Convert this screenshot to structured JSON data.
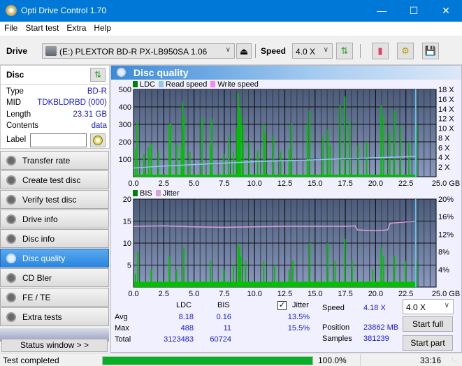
{
  "window": {
    "title": "Opti Drive Control 1.70",
    "minimize_icon": "minimize-icon",
    "maximize_icon": "maximize-icon",
    "close_icon": "close-icon"
  },
  "menu": [
    "File",
    "Start test",
    "Extra",
    "Help"
  ],
  "toolbar": {
    "drive_label": "Drive",
    "drive_value": "(E:)  PLEXTOR BD-R  PX-LB950SA 1.06",
    "speed_label": "Speed",
    "speed_value": "4.0 X",
    "icons": [
      "eject-icon",
      "refresh-swap-icon",
      "eraser-icon",
      "settings-gears-icon",
      "save-icon"
    ]
  },
  "disc": {
    "header": "Disc",
    "fields": [
      {
        "key": "Type",
        "value": "BD-R"
      },
      {
        "key": "MID",
        "value": "TDKBLDRBD (000)"
      },
      {
        "key": "Length",
        "value": "23.31 GB"
      },
      {
        "key": "Contents",
        "value": "data"
      }
    ],
    "label_key": "Label",
    "label_value": ""
  },
  "nav": [
    {
      "label": "Transfer rate",
      "active": false
    },
    {
      "label": "Create test disc",
      "active": false
    },
    {
      "label": "Verify test disc",
      "active": false
    },
    {
      "label": "Drive info",
      "active": false
    },
    {
      "label": "Disc info",
      "active": false
    },
    {
      "label": "Disc quality",
      "active": true
    },
    {
      "label": "CD Bler",
      "active": false
    },
    {
      "label": "FE / TE",
      "active": false
    },
    {
      "label": "Extra tests",
      "active": false
    }
  ],
  "status_window_button": "Status window > >",
  "panel": {
    "title": "Disc quality"
  },
  "colors": {
    "ldc": "#00c000",
    "read_speed": "#8cc8f0",
    "write_speed": "#ff80ff",
    "bis": "#00c000",
    "jitter": "#d8a0d8",
    "plot_bg_top": "#4a5a7a",
    "plot_bg_bottom": "#8a9ac0",
    "accent": "#0078d7",
    "value_text": "#1a1acd",
    "progress": "#06b025"
  },
  "chart_data": [
    {
      "type": "bar",
      "title": "LDC / Read speed",
      "legend": [
        "LDC",
        "Read speed",
        "Write speed"
      ],
      "xlabel": "GB",
      "x_ticks": [
        "0.0",
        "2.5",
        "5.0",
        "7.5",
        "10.0",
        "12.5",
        "15.0",
        "17.5",
        "20.0",
        "22.5",
        "25.0 GB"
      ],
      "xlim": [
        0,
        25
      ],
      "y_ticks_left": [
        "100",
        "200",
        "300",
        "400",
        "500"
      ],
      "ylim_left": [
        0,
        500
      ],
      "y_ticks_right": [
        "2 X",
        "4 X",
        "6 X",
        "8 X",
        "10 X",
        "12 X",
        "14 X",
        "16 X",
        "18 X"
      ],
      "ylim_right": [
        0,
        18
      ],
      "grid": true,
      "legend_position": "top-left",
      "series": [
        {
          "name": "LDC",
          "x": [
            0.1,
            0.25,
            0.8,
            1.2,
            1.4,
            2.0,
            2.9,
            3.0,
            3.5,
            3.9,
            4.0,
            4.1,
            4.6,
            5.6,
            6.3,
            6.4,
            7.4,
            7.8,
            8.2,
            8.5,
            8.6,
            8.7,
            8.8,
            9.0,
            9.5,
            10.2,
            10.7,
            10.8,
            11.5,
            12.1,
            12.8,
            13.0,
            14.3,
            14.5,
            15.6,
            16.0,
            16.2,
            17.0,
            17.4,
            17.8,
            18.5,
            19.2,
            20.4,
            20.6,
            21.1,
            21.5,
            22.0,
            22.7,
            23.3
          ],
          "values": [
            160,
            310,
            130,
            170,
            190,
            150,
            300,
            305,
            190,
            170,
            430,
            340,
            145,
            340,
            180,
            330,
            130,
            240,
            140,
            280,
            475,
            400,
            350,
            300,
            200,
            150,
            300,
            250,
            230,
            145,
            160,
            305,
            300,
            380,
            230,
            270,
            180,
            410,
            460,
            320,
            180,
            200,
            410,
            350,
            260,
            380,
            290,
            200,
            300
          ]
        },
        {
          "name": "Read speed",
          "x": [
            0,
            2.5,
            5,
            7.5,
            10,
            12.5,
            15,
            17.5,
            20,
            22.5,
            23.3
          ],
          "values": [
            1.8,
            2.2,
            2.5,
            2.8,
            3.1,
            3.3,
            3.5,
            3.7,
            3.9,
            4.1,
            4.2
          ],
          "axis": "right"
        },
        {
          "name": "Write speed",
          "x": [],
          "values": []
        }
      ],
      "end_marker_x": 23.31
    },
    {
      "type": "bar",
      "title": "BIS / Jitter",
      "legend": [
        "BIS",
        "Jitter"
      ],
      "xlabel": "GB",
      "x_ticks": [
        "0.0",
        "2.5",
        "5.0",
        "7.5",
        "10.0",
        "12.5",
        "15.0",
        "17.5",
        "20.0",
        "22.5",
        "25.0 GB"
      ],
      "xlim": [
        0,
        25
      ],
      "y_ticks_left": [
        "5",
        "10",
        "15",
        "20"
      ],
      "ylim_left": [
        0,
        20
      ],
      "y_ticks_right": [
        "4%",
        "8%",
        "12%",
        "16%",
        "20%"
      ],
      "ylim_right": [
        0,
        20
      ],
      "grid": true,
      "legend_position": "top-left",
      "series": [
        {
          "name": "BIS",
          "x": [
            0.1,
            0.3,
            1.4,
            2.9,
            3.5,
            4.1,
            6.3,
            7.4,
            8.2,
            8.6,
            8.7,
            8.8,
            9.2,
            10.7,
            11.6,
            12.8,
            13.1,
            14.5,
            16.0,
            16.6,
            17.4,
            18.0,
            19.7,
            20.4,
            20.6,
            21.5,
            22.4,
            23.3
          ],
          "values": [
            3,
            8,
            4,
            7,
            4,
            9,
            6,
            4,
            5,
            10,
            9,
            7,
            6,
            6,
            5,
            4,
            6,
            10,
            10,
            6,
            11,
            6,
            4,
            9,
            7,
            7,
            6,
            6
          ]
        },
        {
          "name": "Jitter",
          "x": [
            0,
            2.5,
            5,
            7.5,
            10,
            12.5,
            15,
            17.5,
            18.3,
            18.5,
            20,
            21.0,
            21.2,
            22.5,
            23.3
          ],
          "values": [
            13.8,
            13.9,
            13.7,
            13.6,
            13.7,
            13.8,
            13.8,
            13.8,
            13.9,
            13.0,
            12.8,
            13.0,
            14.5,
            14.8,
            14.9
          ],
          "axis": "right"
        }
      ],
      "end_marker_x": 23.31
    }
  ],
  "stats": {
    "col_ldc": "LDC",
    "col_bis": "BIS",
    "jitter_label": "Jitter",
    "jitter_checked": true,
    "rows": [
      {
        "label": "Avg",
        "ldc": "8.18",
        "bis": "0.16",
        "jitter": "13.5%"
      },
      {
        "label": "Max",
        "ldc": "488",
        "bis": "11",
        "jitter": "15.5%"
      },
      {
        "label": "Total",
        "ldc": "3123483",
        "bis": "60724",
        "jitter": ""
      }
    ],
    "speed_label": "Speed",
    "speed_value": "4.18 X",
    "position_label": "Position",
    "position_value": "23862 MB",
    "samples_label": "Samples",
    "samples_value": "381239",
    "speed_select": "4.0 X",
    "start_full": "Start full",
    "start_part": "Start part"
  },
  "statusbar": {
    "text": "Test completed",
    "progress_percent": 100.0,
    "progress_text": "100.0%",
    "time": "33:16"
  }
}
